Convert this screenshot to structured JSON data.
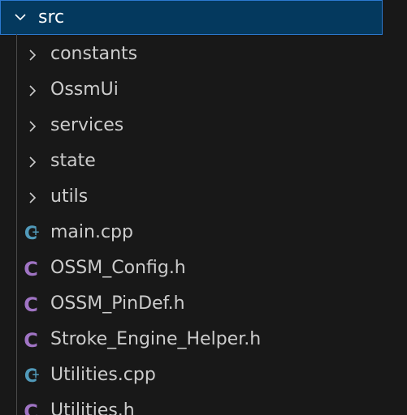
{
  "explorer": {
    "folder": {
      "label": "src",
      "expanded": true
    },
    "items": [
      {
        "label": "constants",
        "kind": "folder",
        "icon": "chevron-right-icon"
      },
      {
        "label": "OssmUi",
        "kind": "folder",
        "icon": "chevron-right-icon"
      },
      {
        "label": "services",
        "kind": "folder",
        "icon": "chevron-right-icon"
      },
      {
        "label": "state",
        "kind": "folder",
        "icon": "chevron-right-icon"
      },
      {
        "label": "utils",
        "kind": "folder",
        "icon": "chevron-right-icon"
      },
      {
        "label": "main.cpp",
        "kind": "file",
        "icon": "cpp-file-icon",
        "glyph": "C"
      },
      {
        "label": "OSSM_Config.h",
        "kind": "file",
        "icon": "c-header-file-icon",
        "glyph": "C"
      },
      {
        "label": "OSSM_PinDef.h",
        "kind": "file",
        "icon": "c-header-file-icon",
        "glyph": "C"
      },
      {
        "label": "Stroke_Engine_Helper.h",
        "kind": "file",
        "icon": "c-header-file-icon",
        "glyph": "C"
      },
      {
        "label": "Utilities.cpp",
        "kind": "file",
        "icon": "cpp-file-icon",
        "glyph": "C"
      },
      {
        "label": "Utilities.h",
        "kind": "file",
        "icon": "c-header-file-icon",
        "glyph": "C"
      }
    ],
    "colors": {
      "background": "#181818",
      "selected_bg": "#04395e",
      "selected_border": "#2b79d0",
      "text": "#cccccc",
      "cpp_icon": "#519aba",
      "c_header_icon": "#a074c4"
    }
  }
}
